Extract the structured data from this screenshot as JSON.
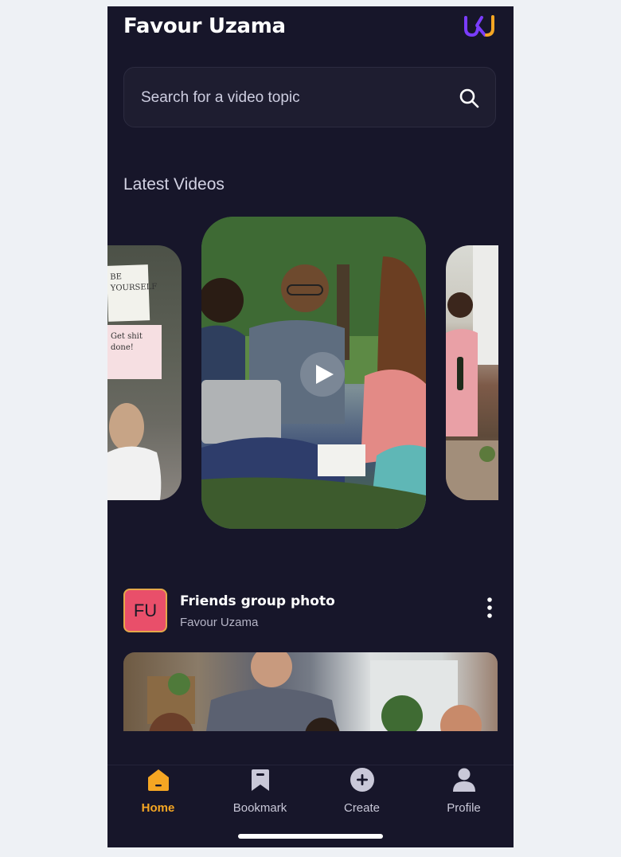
{
  "header": {
    "title": "Favour Uzama",
    "logo_icon": "uk-logo-icon",
    "logo_colors": [
      "#7a3cff",
      "#f5a623"
    ]
  },
  "search": {
    "placeholder": "Search for a video topic",
    "icon": "search-icon"
  },
  "latest": {
    "title": "Latest Videos",
    "notes": [
      "BE YOURSELF",
      "Get shit done!"
    ],
    "play_icon": "play-icon"
  },
  "video": {
    "avatar_initials": "FU",
    "title": "Friends group photo",
    "author": "Favour Uzama",
    "menu_icon": "more-vertical-icon"
  },
  "tabs": [
    {
      "label": "Home",
      "icon": "home-icon",
      "active": true
    },
    {
      "label": "Bookmark",
      "icon": "bookmark-icon",
      "active": false
    },
    {
      "label": "Create",
      "icon": "plus-circle-icon",
      "active": false
    },
    {
      "label": "Profile",
      "icon": "profile-icon",
      "active": false
    }
  ],
  "colors": {
    "background": "#17162a",
    "accent": "#f5a623",
    "avatar_bg": "#e94f6a"
  }
}
